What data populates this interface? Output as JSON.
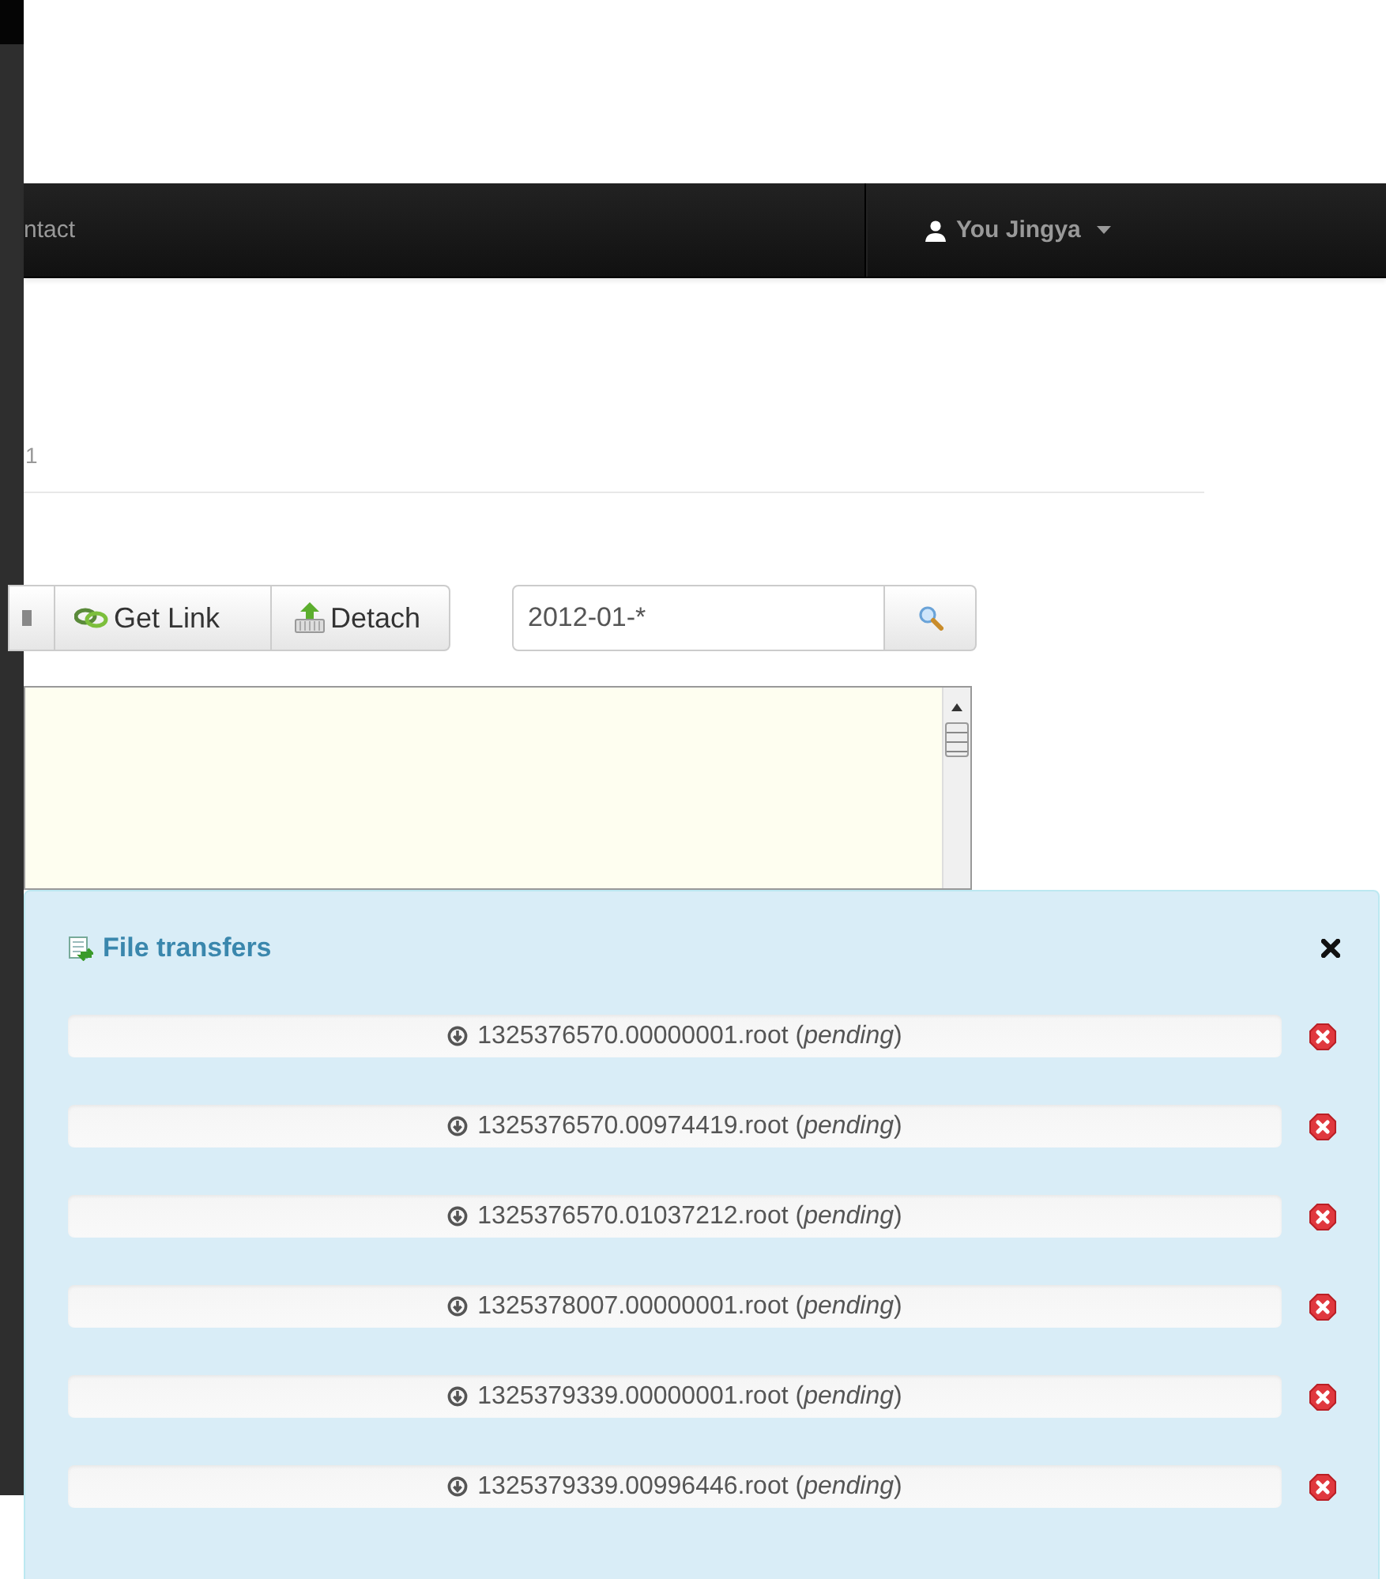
{
  "navbar": {
    "items": [
      {
        "label": "ntact"
      }
    ],
    "user": {
      "label": "You Jingya"
    }
  },
  "page": {
    "tab_fragment": "1"
  },
  "toolbar": {
    "buttons": [
      {
        "kind": "cut"
      },
      {
        "label": "Get Link",
        "kind": "link"
      },
      {
        "label": "Detach",
        "kind": "detach"
      }
    ],
    "search": {
      "value": "2012-01-*"
    }
  },
  "transfers_panel": {
    "title": "File transfers",
    "items": [
      {
        "text": "1325376570.00000001.root (*pending*)",
        "level": 0
      },
      {
        "text": "1325376570.00974419.root (*pending*)",
        "level": 0
      },
      {
        "text": "1325376570.01037212.root (*pending*)",
        "level": 0
      },
      {
        "text": "1325378007.00000001.root (*pending*)",
        "level": 0
      },
      {
        "text": "1325379339.00000001.root (*pending*)",
        "level": 0
      },
      {
        "text": "1325379339.00996446.root (*pending*)",
        "level": 0
      }
    ]
  }
}
